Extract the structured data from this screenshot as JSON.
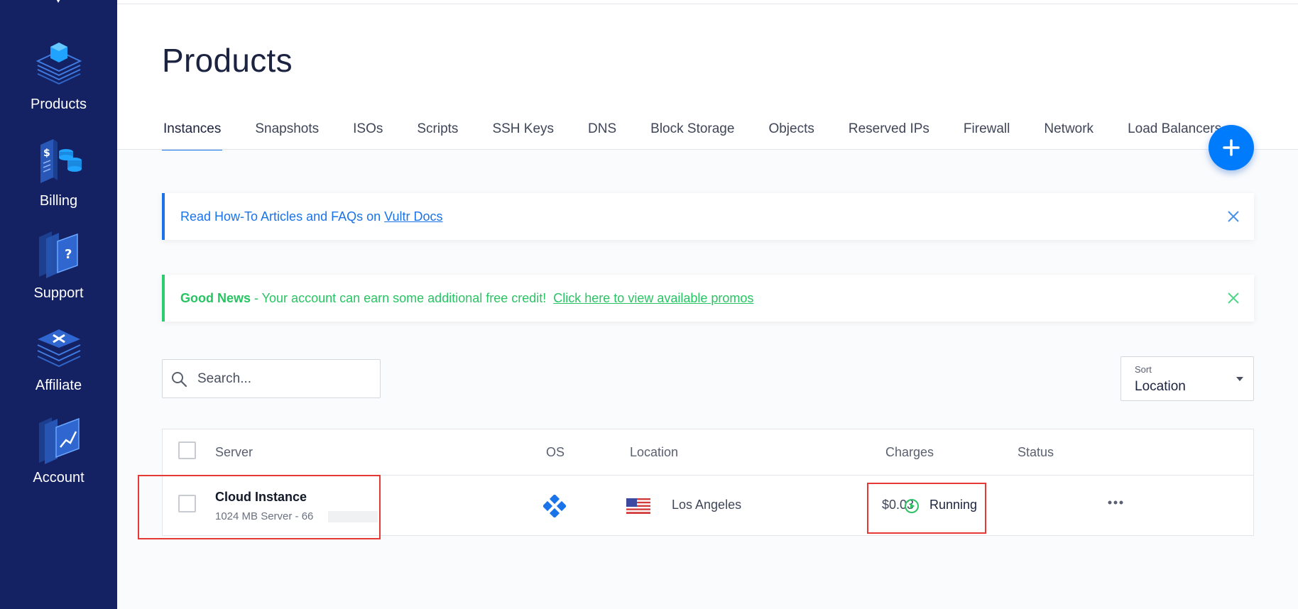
{
  "sidebar": {
    "items": [
      {
        "label": "Products",
        "icon": "products-icon"
      },
      {
        "label": "Billing",
        "icon": "billing-icon"
      },
      {
        "label": "Support",
        "icon": "support-icon"
      },
      {
        "label": "Affiliate",
        "icon": "affiliate-icon"
      },
      {
        "label": "Account",
        "icon": "account-icon"
      }
    ]
  },
  "page": {
    "title": "Products"
  },
  "tabs": [
    {
      "label": "Instances",
      "active": true
    },
    {
      "label": "Snapshots"
    },
    {
      "label": "ISOs"
    },
    {
      "label": "Scripts"
    },
    {
      "label": "SSH Keys"
    },
    {
      "label": "DNS"
    },
    {
      "label": "Block Storage"
    },
    {
      "label": "Objects"
    },
    {
      "label": "Reserved IPs"
    },
    {
      "label": "Firewall"
    },
    {
      "label": "Network"
    },
    {
      "label": "Load Balancers"
    }
  ],
  "alerts": {
    "docs": {
      "text": "Read How-To Articles and FAQs on ",
      "link": "Vultr Docs"
    },
    "promo": {
      "strong": "Good News",
      "text": " - Your account can earn some additional free credit!  ",
      "link": "Click here to view available promos"
    }
  },
  "search": {
    "placeholder": "Search..."
  },
  "sort": {
    "label": "Sort",
    "value": "Location"
  },
  "table": {
    "headers": {
      "server": "Server",
      "os": "OS",
      "location": "Location",
      "charges": "Charges",
      "status": "Status"
    },
    "rows": [
      {
        "name": "Cloud Instance",
        "sub": "1024 MB Server - 66",
        "os_icon": "os-diamond-icon",
        "flag_icon": "us-flag-icon",
        "location": "Los Angeles",
        "charges": "$0.03",
        "status": "Running"
      }
    ]
  },
  "colors": {
    "sidebar": "#142163",
    "accent": "#007bfc",
    "link_blue": "#1a73e8",
    "success_green": "#28c463",
    "highlight_red": "#e53935"
  }
}
